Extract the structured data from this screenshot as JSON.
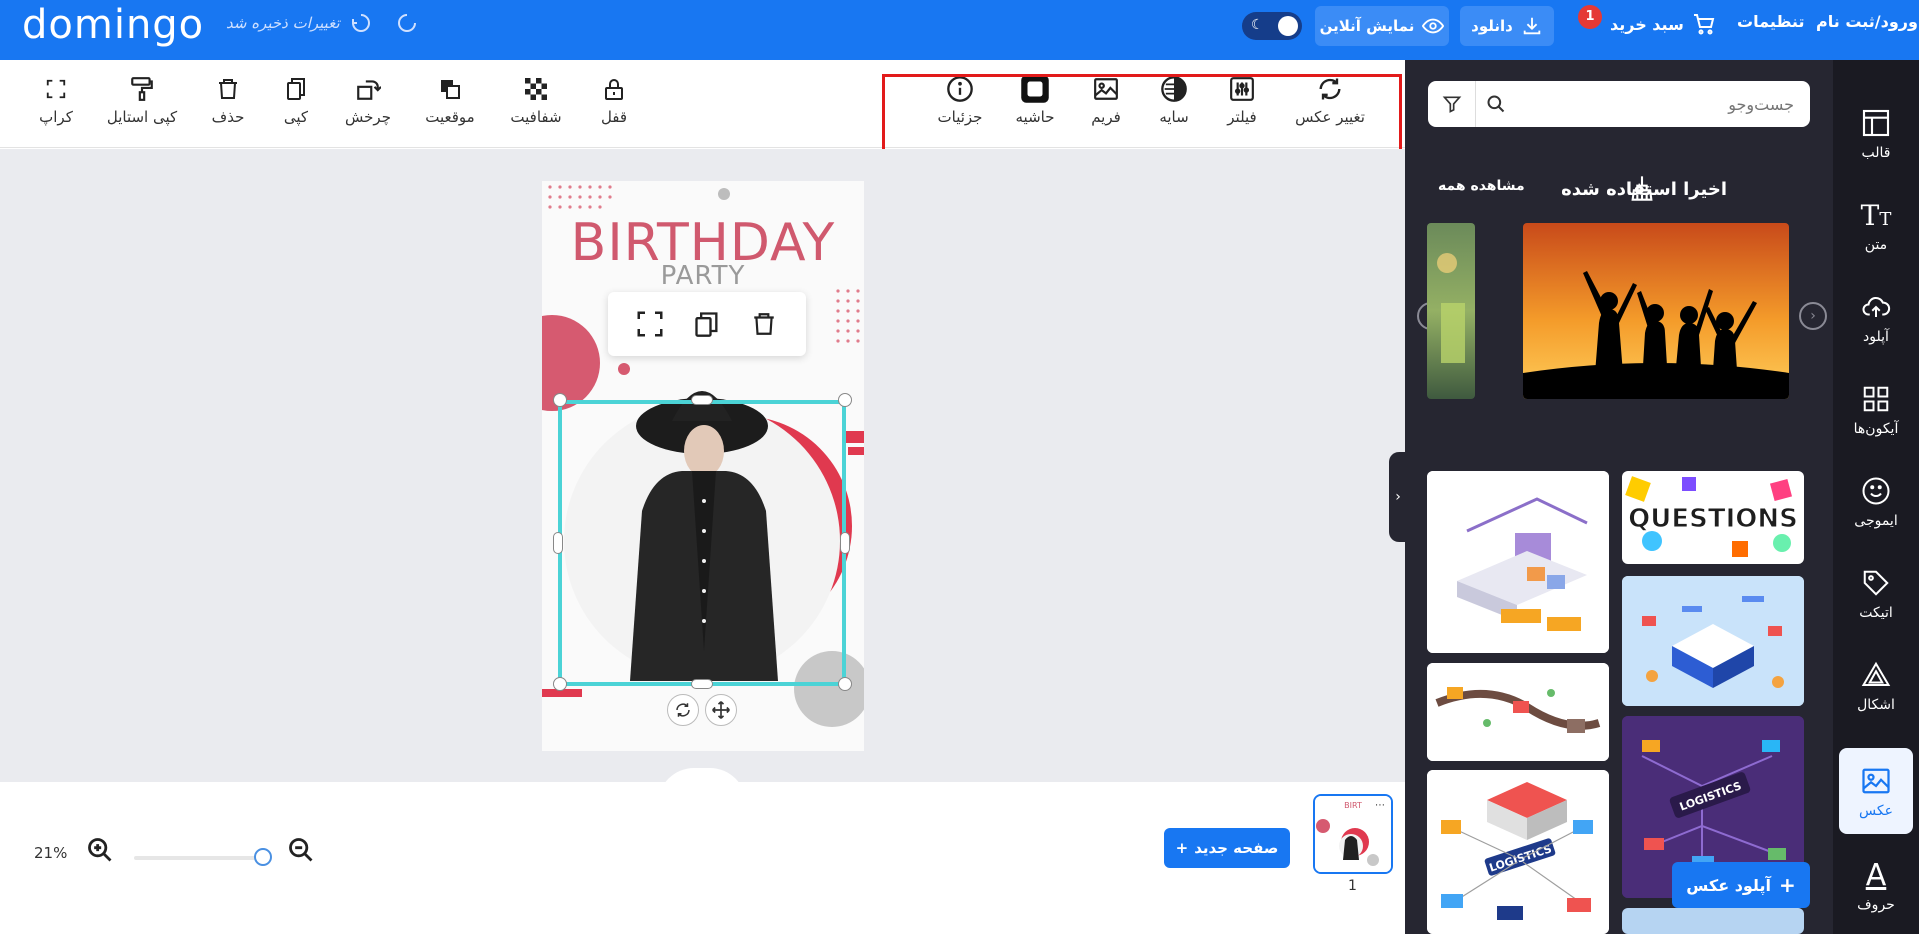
{
  "header": {
    "logo": "domingo",
    "saved_status": "تغییرات ذخیره شد",
    "preview_label": "نمایش آنلاین",
    "download_label": "دانلود",
    "cart_label": "سبد خرید",
    "cart_count": "1",
    "settings_label": "تنظیمات",
    "login_label": "ورود/ثبت نام"
  },
  "toolbar": {
    "left_tools": [
      "کراپ",
      "کپی استایل",
      "حذف",
      "کپی",
      "چرخش",
      "موقعیت",
      "شفافیت",
      "قفل"
    ],
    "image_tools": [
      "جزئیات",
      "حاشیه",
      "فریم",
      "سایه",
      "فیلتر",
      "تغییر عکس"
    ]
  },
  "canvas": {
    "title": "BIRTHDAY",
    "subtitle": "PARTY"
  },
  "bottom": {
    "zoom": "21%",
    "zoom_level": 0.21,
    "new_page_label": "صفحه جدید",
    "page_number": "1"
  },
  "panel": {
    "search_placeholder": "جست‌وجو",
    "recent_title": "اخیرا استفاده شده",
    "see_all": "مشاهده همه",
    "upload_label": "آپلود عکس",
    "grid_texts": {
      "questions": "QUESTIONS",
      "logistics": "LOGISTICS"
    }
  },
  "sidebar": {
    "items": [
      "قالب",
      "متن",
      "آپلود",
      "آیکون‌ها",
      "ایموجی",
      "اتیکت",
      "اشکال",
      "عکس",
      "حروف"
    ],
    "active": "عکس"
  },
  "colors": {
    "brand": "#1877f2",
    "panel_bg": "#262631",
    "sidebar_bg": "#1a1a22",
    "selection": "#4bd3d6",
    "highlight_box": "#e21a1a",
    "birthday_pink": "#d0596e"
  }
}
